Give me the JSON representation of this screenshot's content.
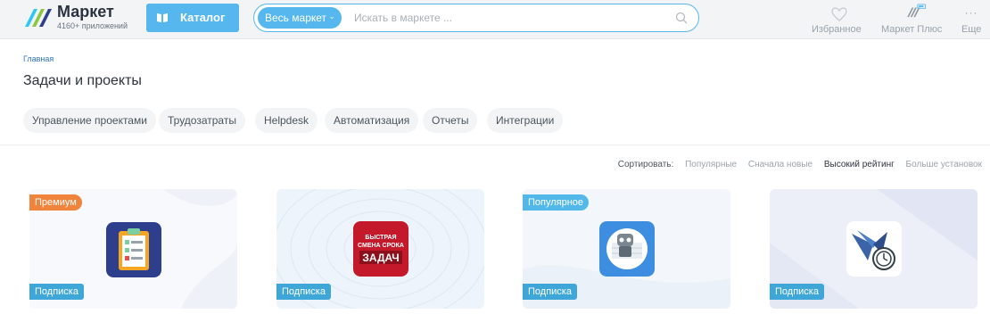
{
  "header": {
    "logo_title": "Маркет",
    "logo_subtitle": "4160+ приложений",
    "catalog_label": "Каталог",
    "search_scope": "Весь маркет",
    "search_placeholder": "Искать в маркете ...",
    "nav": [
      {
        "label": "Избранное",
        "icon": "heart-icon"
      },
      {
        "label": "Маркет Плюс",
        "icon": "market-plus-icon"
      },
      {
        "label": "Еще",
        "icon": "more-icon"
      }
    ]
  },
  "breadcrumb": "Главная",
  "page_title": "Задачи и проекты",
  "tags": [
    "Управление проектами",
    "Трудозатраты",
    "Helpdesk",
    "Автоматизация",
    "Отчеты",
    "Интеграции"
  ],
  "sort": {
    "label": "Сортировать:",
    "options": [
      "Популярные",
      "Сначала новые",
      "Высокий рейтинг",
      "Больше установок"
    ],
    "active": "Высокий рейтинг"
  },
  "cards": [
    {
      "badge": "Премиум",
      "subscription": "Подписка",
      "icon": "checklist-icon"
    },
    {
      "badge": "",
      "subscription": "Подписка",
      "icon": "fast-deadline-icon",
      "icon_text": [
        "БЫСТРАЯ",
        "СМЕНА СРОКА",
        "ЗАДАЧ"
      ]
    },
    {
      "badge": "Популярное",
      "subscription": "Подписка",
      "icon": "robot-table-icon"
    },
    {
      "badge": "",
      "subscription": "Подписка",
      "icon": "bird-clock-icon"
    }
  ],
  "colors": {
    "accent": "#55b7ee",
    "premium": "#f0843c",
    "popular": "#52b8ea",
    "subscription": "#3fa6d8"
  }
}
